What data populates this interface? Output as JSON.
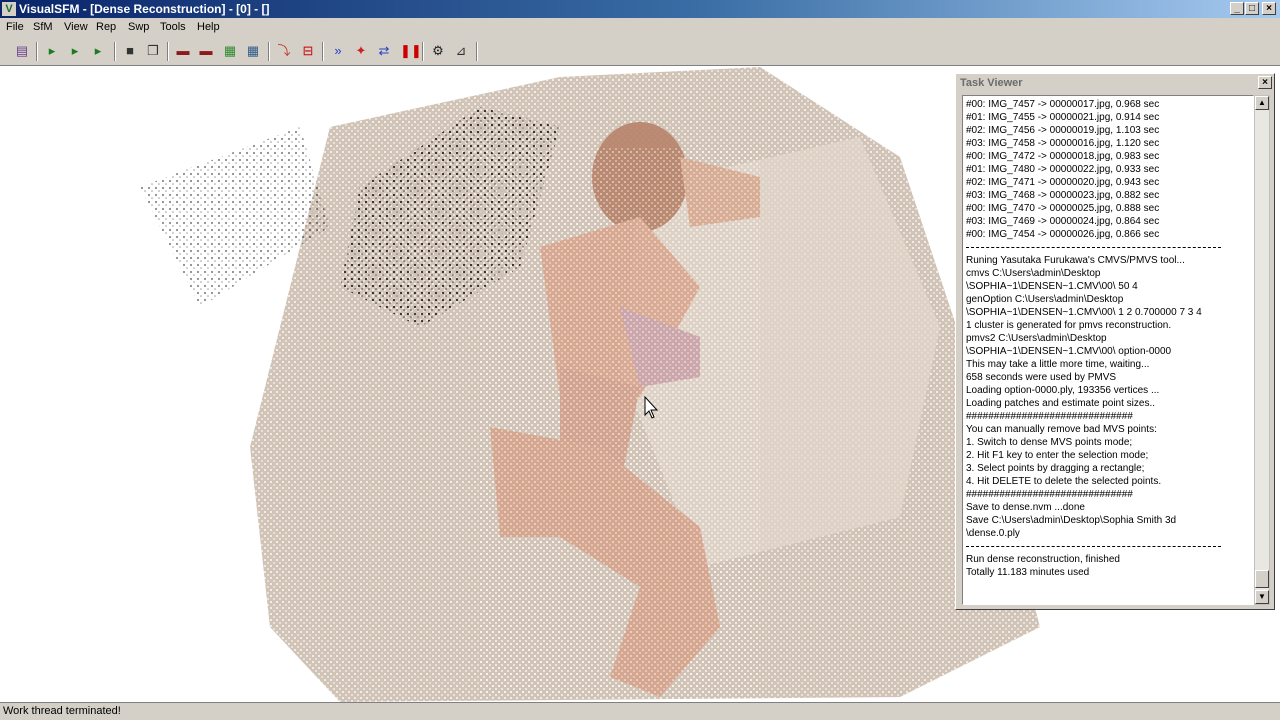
{
  "window": {
    "title": "VisualSFM - [Dense Reconstruction] - [0] - []",
    "app_icon": "visualsfm-logo-icon",
    "controls": {
      "minimize": "_",
      "maximize": "□",
      "close": "×"
    }
  },
  "menu": [
    "File",
    "SfM",
    "View",
    "Rep",
    "Swp",
    "Tools",
    "Help"
  ],
  "toolbar": {
    "icons": [
      "log-window-icon",
      "open-add-images-icon",
      "open-multi-images-icon",
      "open-nvm-icon",
      "save-icon",
      "copy-icon",
      "match-images-icon",
      "load-match-icon",
      "color-map-icon",
      "grid-icon",
      "undo-icon",
      "stop-icon",
      "compute-sfm-icon",
      "reconstruct-sparse-icon",
      "feature-cmp-icon",
      "pause-icon",
      "settings-gear-icon",
      "sort-icon"
    ],
    "icon_glyphs": [
      "▤",
      "▸",
      "▸",
      "▸",
      "■",
      "❐",
      "▬",
      "▬",
      "▦",
      "▦",
      "⤵",
      "⊟",
      "»",
      "✦",
      "⇄",
      "❚❚",
      "⚙",
      "⊿"
    ],
    "icon_colors": [
      "#6b3f8c",
      "#1f7a1f",
      "#1f7a1f",
      "#1f7a1f",
      "#333333",
      "#333333",
      "#8b1a1a",
      "#8b1a1a",
      "#2e8b2e",
      "#2e5a8b",
      "#c0392b",
      "#cc0000",
      "#1f3fbf",
      "#cc2222",
      "#2a3fbf",
      "#cc0000",
      "#222222",
      "#333333"
    ]
  },
  "viewport": {
    "description": "dense point cloud render",
    "colors": {
      "bed": "#c8b8a8",
      "skin": "#d7a68c",
      "dark": "#5a3a30",
      "background": "#ffffff"
    }
  },
  "task_viewer": {
    "title": "Task Viewer",
    "close": "×",
    "lines": [
      "#00: IMG_7457 -> 00000017.jpg, 0.968 sec",
      "#01: IMG_7455 -> 00000021.jpg, 0.914 sec",
      "#02: IMG_7456 -> 00000019.jpg, 1.103 sec",
      "#03: IMG_7458 -> 00000016.jpg, 1.120 sec",
      "#00: IMG_7472 -> 00000018.jpg, 0.983 sec",
      "#01: IMG_7480 -> 00000022.jpg, 0.933 sec",
      "#02: IMG_7471 -> 00000020.jpg, 0.943 sec",
      "#03: IMG_7468 -> 00000023.jpg, 0.882 sec",
      "#00: IMG_7470 -> 00000025.jpg, 0.888 sec",
      "#03: IMG_7469 -> 00000024.jpg, 0.864 sec",
      "#00: IMG_7454 -> 00000026.jpg, 0.866 sec",
      "",
      "Runing Yasutaka Furukawa's CMVS/PMVS tool...",
      "cmvs C:\\Users\\admin\\Desktop",
      "\\SOPHIA~1\\DENSEN~1.CMV\\00\\ 50 4",
      "genOption C:\\Users\\admin\\Desktop",
      "\\SOPHIA~1\\DENSEN~1.CMV\\00\\ 1 2 0.700000 7 3 4",
      "1 cluster is generated for pmvs reconstruction.",
      "pmvs2 C:\\Users\\admin\\Desktop",
      "\\SOPHIA~1\\DENSEN~1.CMV\\00\\ option-0000",
      "This may take a little more time, waiting...",
      "658 seconds were used by PMVS",
      "Loading option-0000.ply, 193356 vertices ...",
      "Loading  patches and estimate point sizes..",
      "##############################",
      "You can manually remove bad MVS points:",
      "1. Switch to dense MVS points mode;",
      "2. Hit F1 key to enter the selection mode;",
      "3. Select points by dragging a rectangle;",
      "4. Hit DELETE to delete the selected points.",
      "##############################",
      "Save to dense.nvm ...done",
      "Save C:\\Users\\admin\\Desktop\\Sophia Smith 3d",
      "\\dense.0.ply",
      "",
      "Run dense reconstruction, finished",
      "Totally 11.183 minutes used"
    ],
    "scroll": {
      "up": "▲",
      "down": "▼"
    }
  },
  "status": "Work thread terminated!"
}
